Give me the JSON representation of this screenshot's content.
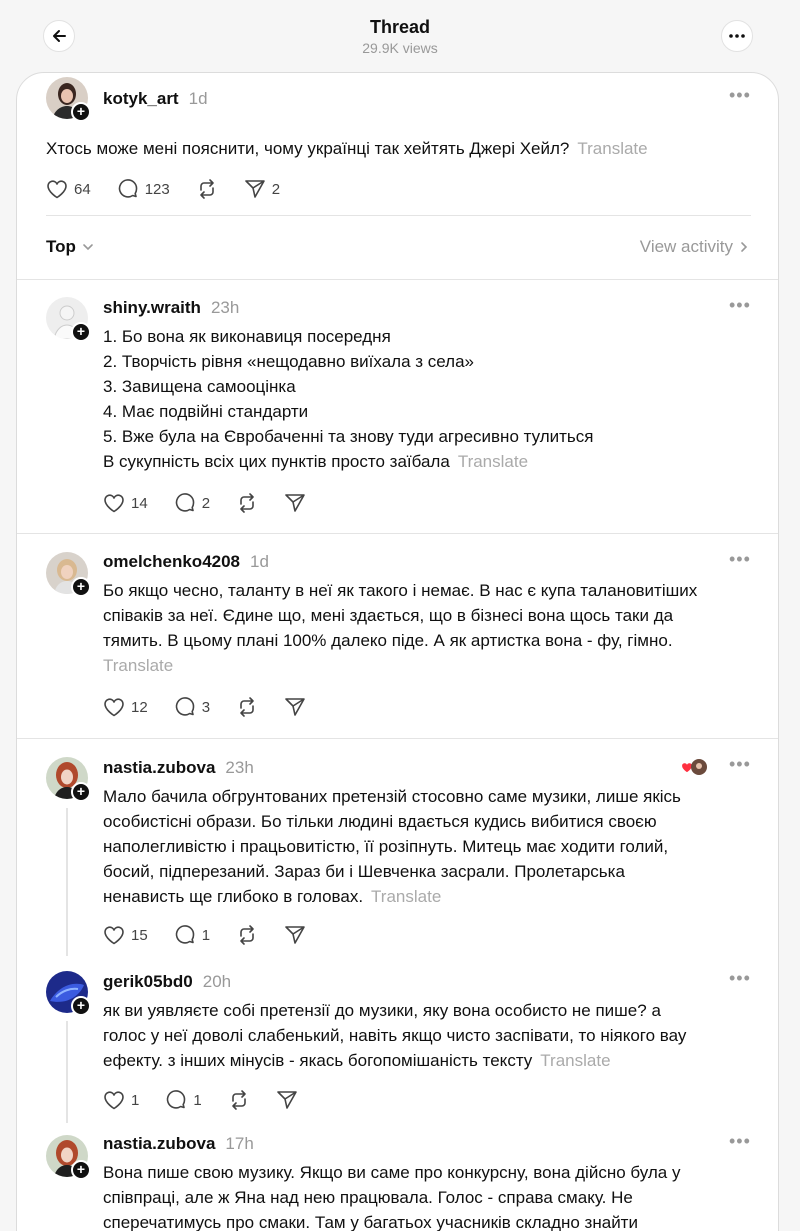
{
  "header": {
    "title": "Thread",
    "views": "29.9K views"
  },
  "original_post": {
    "username": "kotyk_art",
    "time": "1d",
    "text": "Хтось може мені пояснити, чому українці так хейтять Джері Хейл?",
    "translate_label": "Translate",
    "likes": "64",
    "replies": "123",
    "reposts": "",
    "shares": "2"
  },
  "sort": {
    "label": "Top",
    "view_activity": "View activity"
  },
  "replies": [
    {
      "username": "shiny.wraith",
      "time": "23h",
      "lines": [
        "1. Бо вона як виконавиця посередня",
        "2. Творчість рівня «нещодавно виїхала з села»",
        "3. Завищена самооцінка",
        "4. Має подвійні стандарти",
        "5. Вже була на Євробаченні та знову туди агресивно тулиться",
        "В сукупність всіх цих пунктів просто заїбала"
      ],
      "translate_label": "Translate",
      "likes": "14",
      "replies": "2"
    },
    {
      "username": "omelchenko4208",
      "time": "1d",
      "lines": [
        "Бо якщо чесно, таланту в неї як такого і немає. В нас є купа талановитіших",
        "співаків за неї. Єдине що, мені здається, що в бізнесі вона щось таки да",
        "тямить. В цьому плані 100% далеко піде. А як артистка вона - фу, гімно."
      ],
      "translate_label": "Translate",
      "likes": "12",
      "replies": "3"
    },
    {
      "username": "nastia.zubova",
      "time": "23h",
      "lines": [
        "Мало бачила обгрунтованих претензій стосовно саме музики, лише якісь",
        "особистісні образи. Бо тільки людині вдається кудись вибитися своєю",
        "наполегливістю і працьовитістю, її розіпнуть. Митець має ходити голий,",
        "босий, підперезаний. Зараз би і Шевченка засрали. Пролетарська",
        "ненависть ще глибоко в головах."
      ],
      "translate_label": "Translate",
      "likes": "15",
      "replies": "1"
    },
    {
      "username": "gerik05bd0",
      "time": "20h",
      "lines": [
        "як ви уявляєте собі претензії до музики, яку вона особисто не пише? а",
        "голос у неї доволі слабенький, навіть якщо чисто заспівати, то ніякого вау",
        "ефекту. з інших мінусів - якась богопомішаність тексту"
      ],
      "translate_label": "Translate",
      "likes": "1",
      "replies": "1"
    },
    {
      "username": "nastia.zubova",
      "time": "17h",
      "lines": [
        "Вона пише свою музику. Якщо ви саме про конкурсну, вона дійсно була у",
        "співпраці, але ж Яна над нею працювала. Голос - справа смаку. Не",
        "сперечатимусь про смаки. Там у багатьох учасників складно знайти"
      ],
      "likes": "",
      "replies": ""
    }
  ],
  "colors": {
    "text": "#101010",
    "muted": "#999999",
    "divider": "#e4e4e4",
    "heart_red": "#ff3040"
  },
  "icons": [
    "back-arrow-icon",
    "more-icon",
    "heart-icon",
    "comment-icon",
    "repost-icon",
    "share-icon",
    "chevron-down-icon",
    "chevron-right-icon",
    "plus-icon"
  ]
}
